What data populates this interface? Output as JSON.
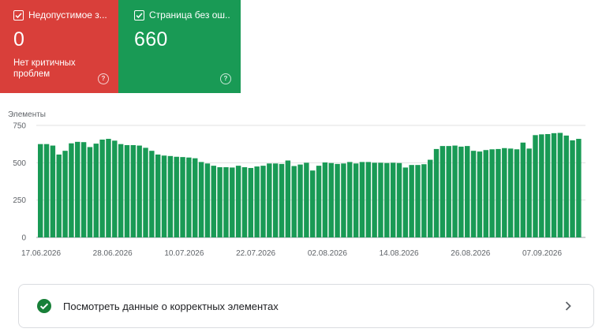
{
  "cards": {
    "error": {
      "title": "Недопустимое з...",
      "value": "0",
      "description": "Нет критичных проблем",
      "color": "#d93f3a",
      "help_icon": "question-circle-icon"
    },
    "valid": {
      "title": "Страница без ош...",
      "value": "660",
      "color": "#199a55",
      "help_icon": "question-circle-icon"
    }
  },
  "chart_data": {
    "type": "bar",
    "ylabel": "Элементы",
    "ylim": [
      0,
      750
    ],
    "yticks": [
      "0",
      "250",
      "500",
      "750"
    ],
    "xtick_labels": [
      "17.06.2026",
      "28.06.2026",
      "10.07.2026",
      "22.07.2026",
      "02.08.2026",
      "14.08.2026",
      "26.08.2026",
      "07.09.2026"
    ],
    "bar_color": "#199a55",
    "grid": true,
    "values": [
      625,
      625,
      615,
      555,
      580,
      630,
      640,
      638,
      605,
      628,
      655,
      660,
      648,
      625,
      618,
      618,
      615,
      600,
      580,
      555,
      548,
      545,
      540,
      538,
      535,
      530,
      505,
      495,
      480,
      470,
      470,
      468,
      480,
      470,
      465,
      475,
      480,
      495,
      495,
      492,
      515,
      478,
      488,
      500,
      448,
      480,
      502,
      498,
      492,
      495,
      505,
      495,
      505,
      505,
      500,
      500,
      498,
      500,
      498,
      468,
      485,
      485,
      490,
      520,
      592,
      612,
      612,
      615,
      608,
      612,
      580,
      575,
      585,
      590,
      592,
      598,
      595,
      590,
      635,
      595,
      685,
      690,
      692,
      698,
      700,
      682,
      650,
      660
    ]
  },
  "link": {
    "text": "Посмотреть данные о корректных элементах",
    "icon": "check-circle-icon",
    "arrow": "chevron-right-icon"
  }
}
